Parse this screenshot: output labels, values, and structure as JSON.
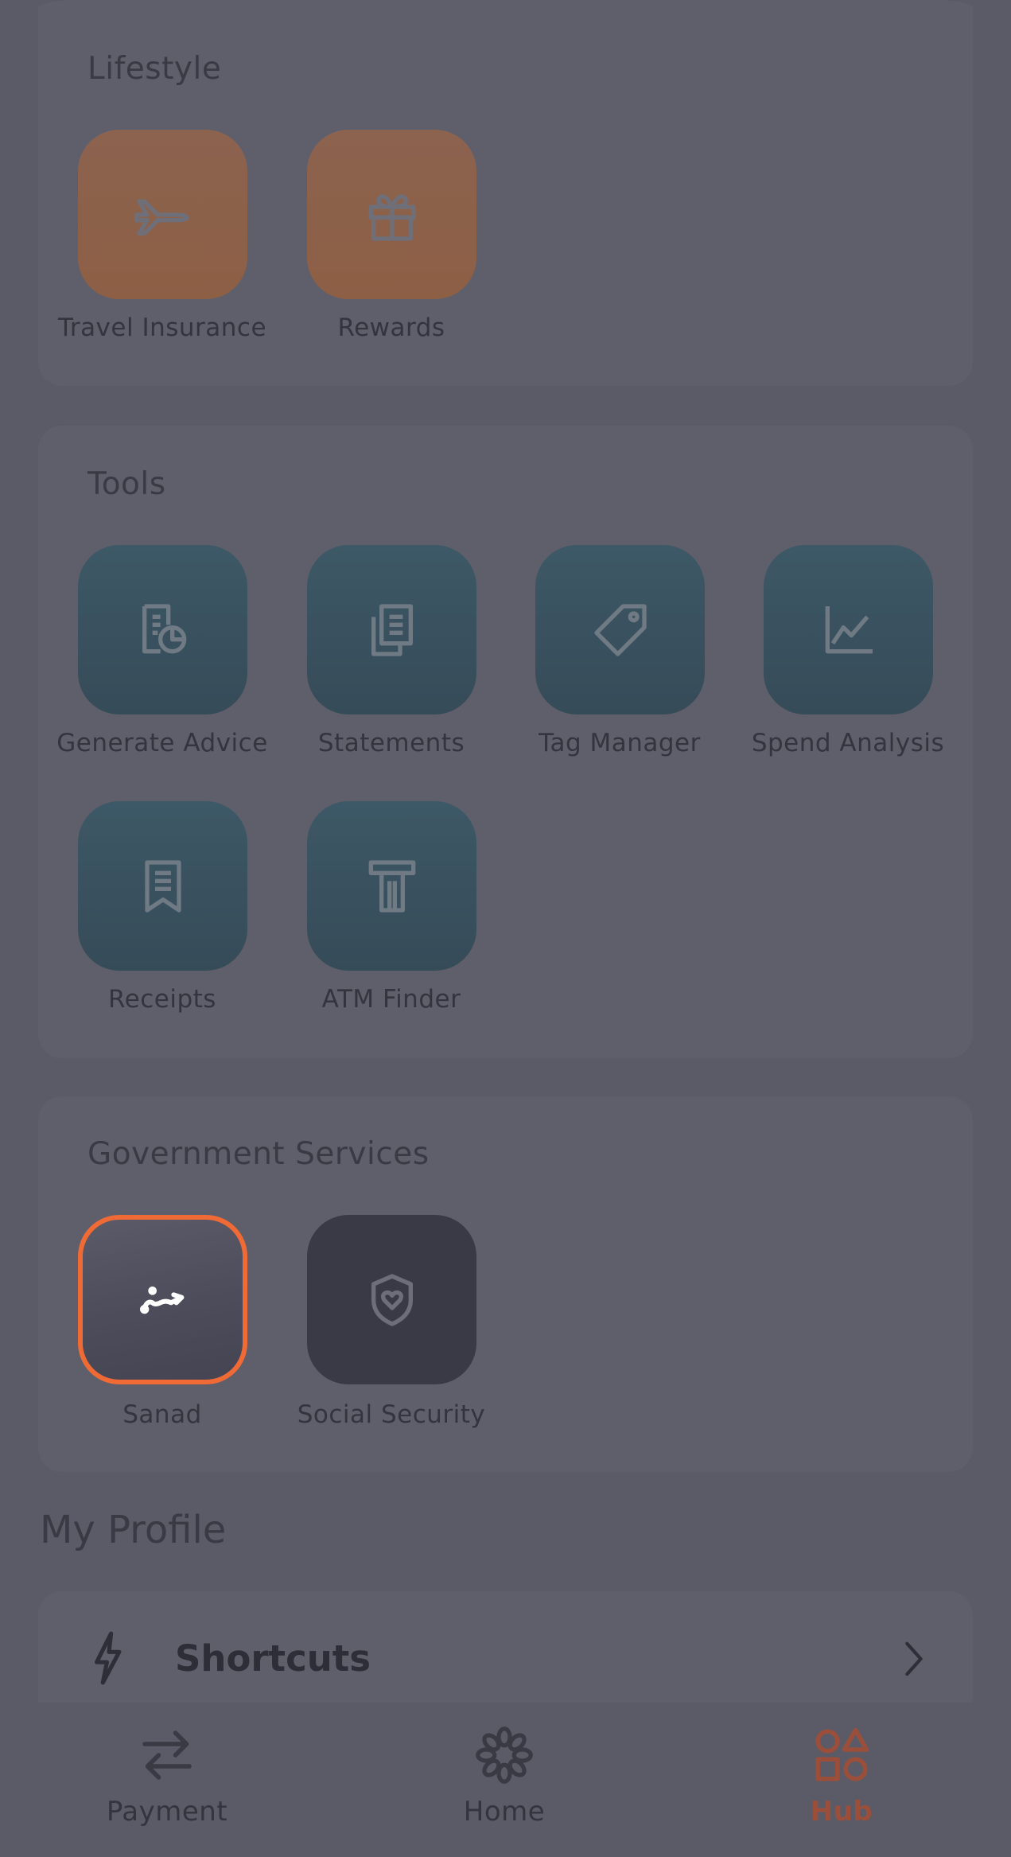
{
  "lifestyle": {
    "title": "Lifestyle",
    "items": [
      {
        "label": "Travel Insurance",
        "icon": "airplane-icon"
      },
      {
        "label": "Rewards",
        "icon": "gift-icon"
      }
    ]
  },
  "tools": {
    "title": "Tools",
    "items": [
      {
        "label": "Generate Advice",
        "icon": "document-chart-icon"
      },
      {
        "label": "Statements",
        "icon": "documents-icon"
      },
      {
        "label": "Tag Manager",
        "icon": "tag-icon"
      },
      {
        "label": "Spend Analysis",
        "icon": "line-chart-icon"
      },
      {
        "label": "Receipts",
        "icon": "receipt-icon"
      },
      {
        "label": "ATM Finder",
        "icon": "atm-icon"
      }
    ]
  },
  "government": {
    "title": "Government Services",
    "items": [
      {
        "label": "Sanad",
        "icon": "sanad-logo-icon"
      },
      {
        "label": "Social Security",
        "icon": "shield-heart-icon"
      }
    ]
  },
  "profile": {
    "title": "My Profile",
    "shortcuts_label": "Shortcuts"
  },
  "tabbar": {
    "items": [
      {
        "label": "Payment",
        "icon": "transfer-arrows-icon"
      },
      {
        "label": "Home",
        "icon": "flower-logo-icon"
      },
      {
        "label": "Hub",
        "icon": "shapes-icon",
        "active": true
      }
    ]
  },
  "colors": {
    "background": "#5b5b67",
    "accent_orange": "#f06a35",
    "lifestyle_tile": "#8d5f45",
    "tools_tile": "#364b58",
    "gov_tile": "#3a3a47",
    "active_tab": "#9b4f3b"
  }
}
